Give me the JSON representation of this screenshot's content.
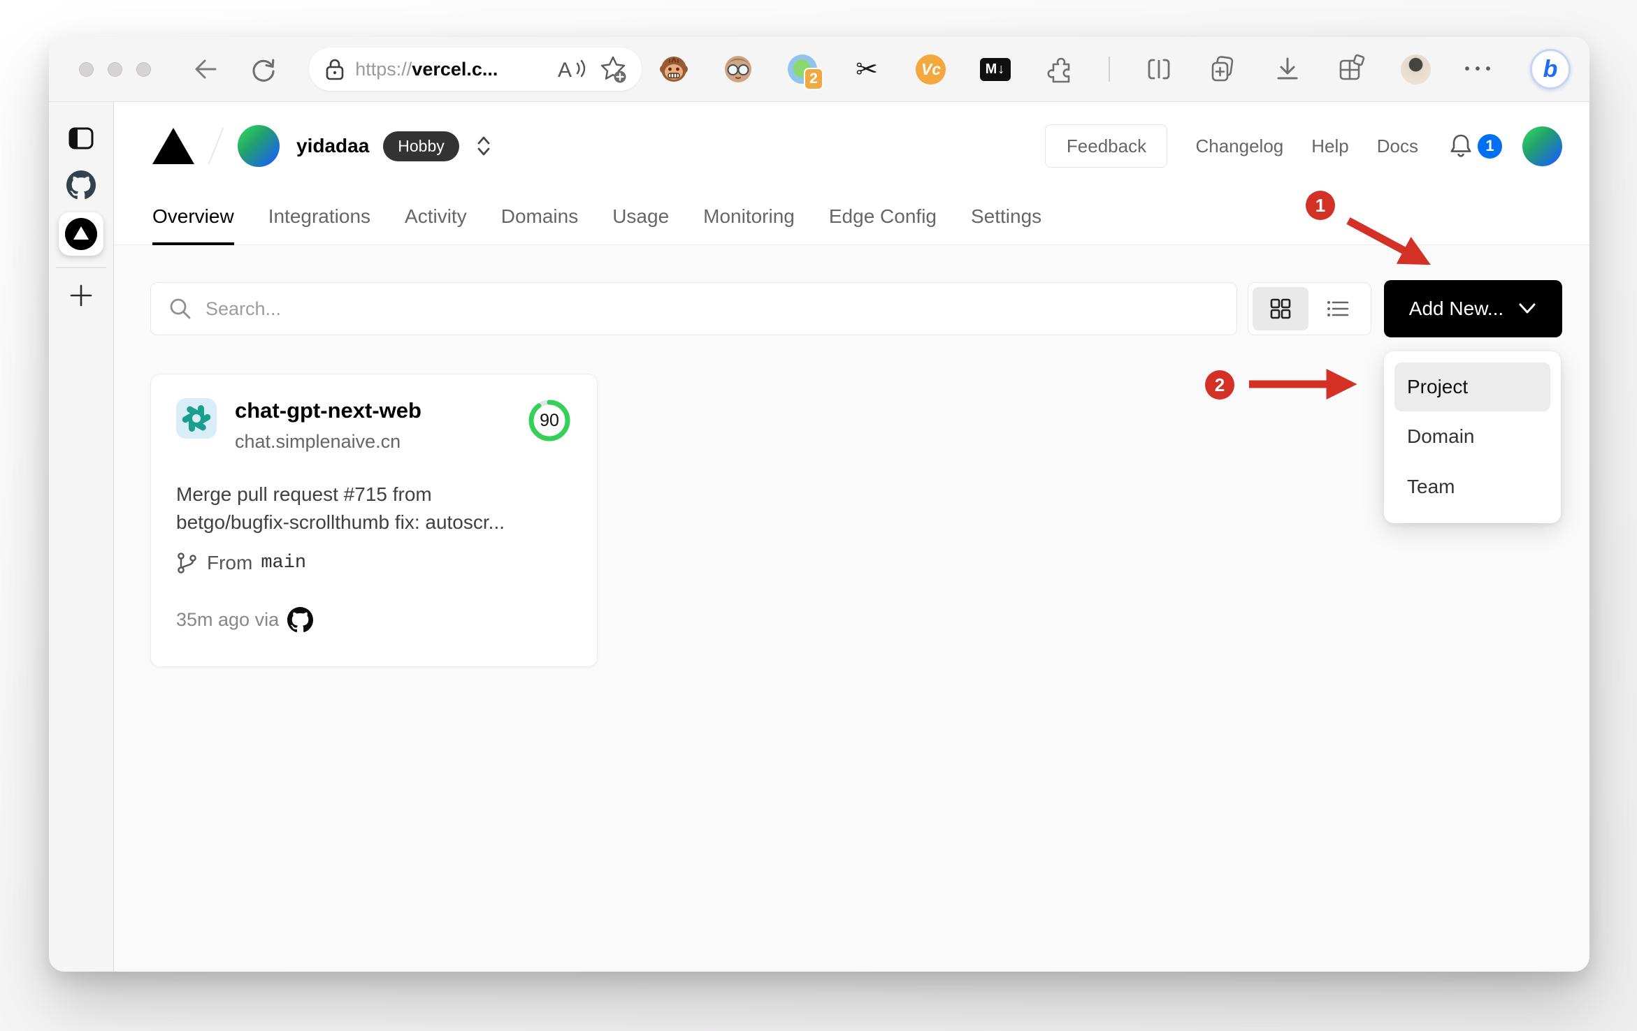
{
  "browser": {
    "url_scheme": "https://",
    "url_host": "vercel.c...",
    "tabs_extension_badge": "2",
    "vc_extension_label": "Vc",
    "markdown_extension_label": "M↓",
    "bing_label": "b"
  },
  "vercel": {
    "team": {
      "name": "yidadaa",
      "plan": "Hobby"
    },
    "header_links": {
      "feedback": "Feedback",
      "changelog": "Changelog",
      "help": "Help",
      "docs": "Docs",
      "notification_count": "1"
    },
    "tabs": [
      {
        "label": "Overview",
        "active": true
      },
      {
        "label": "Integrations",
        "active": false
      },
      {
        "label": "Activity",
        "active": false
      },
      {
        "label": "Domains",
        "active": false
      },
      {
        "label": "Usage",
        "active": false
      },
      {
        "label": "Monitoring",
        "active": false
      },
      {
        "label": "Edge Config",
        "active": false
      },
      {
        "label": "Settings",
        "active": false
      }
    ],
    "toolbar": {
      "search_placeholder": "Search...",
      "add_new_label": "Add New..."
    },
    "add_new_menu": {
      "items": [
        {
          "label": "Project",
          "highlighted": true
        },
        {
          "label": "Domain",
          "highlighted": false
        },
        {
          "label": "Team",
          "highlighted": false
        }
      ]
    },
    "project_card": {
      "name": "chat-gpt-next-web",
      "domain": "chat.simplenaive.cn",
      "score": "90",
      "commit_line1": "Merge pull request #715 from",
      "commit_line2": "betgo/bugfix-scrollthumb fix: autoscr...",
      "branch_label": "From",
      "branch_name": "main",
      "time_info": "35m ago via"
    }
  },
  "annotations": {
    "step1": "1",
    "step2": "2"
  },
  "colors": {
    "accent_blue": "#0070f3",
    "annotation_red": "#d33026",
    "score_green": "#34d058",
    "openai_teal": "#19a08c",
    "badge_orange": "#f0a841",
    "plan_badge_bg": "#333333"
  }
}
